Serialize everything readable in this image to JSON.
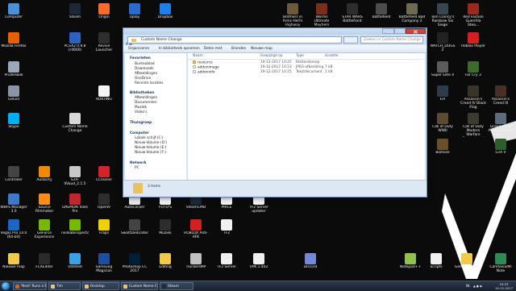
{
  "desktop_icons": [
    {
      "label": "Computer",
      "color": "#4a90d9"
    },
    {
      "label": "Steam",
      "color": "#1b2838"
    },
    {
      "label": "Origin",
      "color": "#f56c2d"
    },
    {
      "label": "Uplay",
      "color": "#2a6ad1"
    },
    {
      "label": "Dropbox",
      "color": "#1f7ee8"
    },
    {
      "label": "Brothers in Arms Hell's Highway",
      "color": "#6b5a3c"
    },
    {
      "label": "Worms Ultimate Mayhem",
      "color": "#7a2f1d"
    },
    {
      "label": "STAR WARS Battlefront",
      "color": "#2d2d2d"
    },
    {
      "label": "Battlefield",
      "color": "#4c4c4c"
    },
    {
      "label": "Battlefield Bad Company 2",
      "color": "#6f6a54"
    },
    {
      "label": "Tom Clancy's Rainbow Six Siege",
      "color": "#3a4552"
    },
    {
      "label": "Red Faction Guerrilla Stea...",
      "color": "#9a2a1c"
    },
    {
      "label": "Mozilla Firefox",
      "color": "#e66000"
    },
    {
      "label": "PCSX2 0.9.8 (r4600)",
      "color": "#3060c0"
    },
    {
      "label": "Revive Launcher",
      "color": "#2e2e2e"
    },
    {
      "label": "WATCH_DOGS 2",
      "color": "#222222"
    },
    {
      "label": "Roblox Player",
      "color": "#d02020"
    },
    {
      "label": "Prullenbak",
      "color": "#9aa8b8"
    },
    {
      "label": "Super Elite 4",
      "color": "#5c5c5c"
    },
    {
      "label": "Far Cry 3",
      "color": "#3e6a2e"
    },
    {
      "label": "Geluid",
      "color": "#8a96a8"
    },
    {
      "label": "KORTING",
      "color": "#f4f4f4"
    },
    {
      "label": "EFI",
      "color": "#2e3b4a"
    },
    {
      "label": "Assassin's Creed IV Black Flag",
      "color": "#3a3328"
    },
    {
      "label": "Assassin's Creed III",
      "color": "#4a2f26"
    },
    {
      "label": "Skype",
      "color": "#00aff0"
    },
    {
      "label": "Custom Name Change",
      "color": "#d8d8d8"
    },
    {
      "label": "Call of Duty WWII",
      "color": "#5d4a32"
    },
    {
      "label": "Call of Duty Modern Warfare Remastered",
      "color": "#3b3b2f"
    },
    {
      "label": "Grand Theft Auto Episodes from ...",
      "color": "#5c6c7c"
    },
    {
      "label": "Biohock",
      "color": "#6b4f2a"
    },
    {
      "label": "GTA V",
      "color": "#2e5d2e"
    },
    {
      "label": "Controller",
      "color": "#444444"
    },
    {
      "label": "Audacity",
      "color": "#f28a00"
    },
    {
      "label": "GTA-IIVaud_2.1.5",
      "color": "#c8c8c8"
    },
    {
      "label": "CCleaner",
      "color": "#d4242a"
    },
    {
      "label": "WBFS Manager 3.0",
      "color": "#3c7ac9"
    },
    {
      "label": "Source Filmmaker",
      "color": "#ff8c1a"
    },
    {
      "label": "DAEMON Tools Pro",
      "color": "#c0272d"
    },
    {
      "label": "OpenIV",
      "color": "#2d2d2d"
    },
    {
      "label": "AutoClicker",
      "color": "#e7e7e7"
    },
    {
      "label": "FOTO'S",
      "color": "#f0f0f0"
    },
    {
      "label": "SteamCMD",
      "color": "#1b2838"
    },
    {
      "label": "PRICE",
      "color": "#f0f0f0"
    },
    {
      "label": "TF2 Server updater",
      "color": "#f0f0f0"
    },
    {
      "label": "Vegas Pro 14.0 (64-bit)",
      "color": "#1a66c4"
    },
    {
      "label": "GeForce Experience",
      "color": "#76b900"
    },
    {
      "label": "nvidiabinspector",
      "color": "#76b900"
    },
    {
      "label": "Fraps",
      "color": "#f0d000"
    },
    {
      "label": "SwattDedicatedSe...",
      "color": "#444444"
    },
    {
      "label": "Muziek",
      "color": "#2d2d2d"
    },
    {
      "label": "ROBLOX Anti-AFK",
      "color": "#d02020"
    },
    {
      "label": "TF2",
      "color": "#f0f0f0"
    },
    {
      "label": "Nieuwe map",
      "color": "#f2c94c"
    },
    {
      "label": "FCXEditor",
      "color": "#2a2a2a"
    },
    {
      "label": "Untitled",
      "color": "#3da0e0"
    },
    {
      "label": "Samsung Magician",
      "color": "#1b4fa3"
    },
    {
      "label": "Photoshop CC 2017",
      "color": "#001e36"
    },
    {
      "label": "Editing",
      "color": "#f2c94c"
    },
    {
      "label": "TruckersMP",
      "color": "#c0c0c0"
    },
    {
      "label": "TF2 Server",
      "color": "#f0f0f0"
    },
    {
      "label": "VPK 1.402",
      "color": "#f0f0f0"
    },
    {
      "label": "Discord",
      "color": "#7289da"
    },
    {
      "label": "Notepad++",
      "color": "#90c050"
    },
    {
      "label": "Scripts",
      "color": "#f0f0f0"
    },
    {
      "label": "Gemis dingen",
      "color": "#f2c94c"
    },
    {
      "label": "Camtasia/Mi Note",
      "color": "#2e8b57"
    }
  ],
  "explorer": {
    "title": "",
    "address": "Custom Name Change",
    "search_placeholder": "Zoeken in Custom Name Change",
    "toolbar": {
      "organize": "Organiseren",
      "open_in_library": "In bibliotheek opnemen",
      "share": "Delen met",
      "burn": "Branden",
      "new_folder": "Nieuwe map"
    },
    "sidebar": {
      "favorites": "Favorieten",
      "desktop": "Bureaublad",
      "downloads": "Downloads",
      "recent_images": "Afbeeldingen",
      "onedrive": "OneDrive",
      "recent_locations": "Recente locaties",
      "libraries": "Bibliotheken",
      "pictures": "Afbeeldingen",
      "documents": "Documenten",
      "music": "Muziek",
      "videos": "Video's",
      "homegroup": "Thuisgroep",
      "computer": "Computer",
      "local_disk": "Lokale schijf (C:)",
      "vol_d": "Nieuw-Volume (D:)",
      "vol_e": "Nieuw-Volume (E:)",
      "vol_f": "Nieuw-Volume (F:)",
      "network": "Netwerk",
      "network_item": "PC"
    },
    "columns": {
      "name": "Naam",
      "date": "Gewijzigd op",
      "type": "Type",
      "size": "Grootte"
    },
    "files": [
      {
        "name": "resource",
        "date": "19-12-2017 10:25",
        "type": "Bestandsmap",
        "size": ""
      },
      {
        "name": "addonimage",
        "date": "19-12-2017 10:23",
        "type": "JPEG-afbeelding",
        "size": "7 kB"
      },
      {
        "name": "addoninfo",
        "date": "19-12-2017 10:25",
        "type": "Tekstdocument",
        "size": "1 kB"
      }
    ],
    "status": "3 items"
  },
  "taskbar": {
    "items": [
      {
        "label": "'Nest' Runs a Bo...",
        "color": "#e66000"
      },
      {
        "label": "Tim",
        "color": "#f2c94c"
      },
      {
        "label": "Desktop",
        "color": "#f2c94c"
      },
      {
        "label": "Custom Name Ch...",
        "color": "#f2c94c"
      },
      {
        "label": "Steam",
        "color": "#1b2838"
      }
    ],
    "lang": "NL",
    "time": "10:23",
    "date": "19-12-2017"
  },
  "colors": {
    "accent": "#3c7fb1",
    "checkmark": "#ffffff"
  }
}
